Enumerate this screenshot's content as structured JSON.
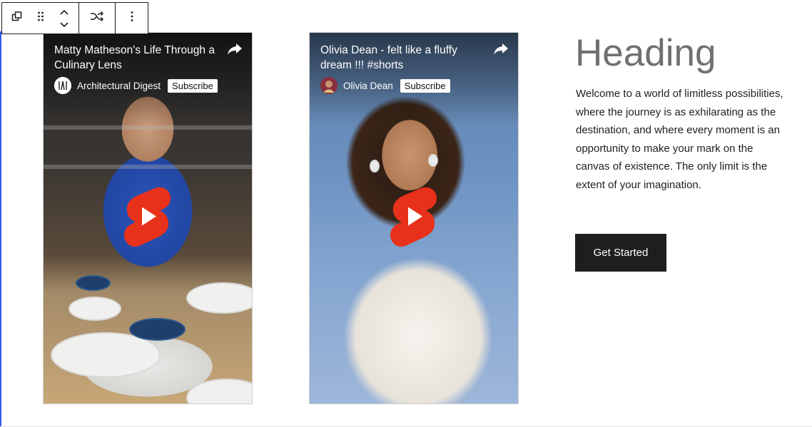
{
  "toolbar": {
    "icons": [
      "duplicate-block-icon",
      "drag-handle-icon",
      "move-up-icon",
      "move-down-icon",
      "shuffle-icon",
      "more-options-icon"
    ]
  },
  "videos": [
    {
      "title": "Matty Matheson's Life Through a Culinary Lens",
      "channel": "Architectural Digest",
      "subscribe_label": "Subscribe",
      "icons": [
        "share-icon",
        "channel-avatar-icon",
        "youtube-shorts-play-icon"
      ]
    },
    {
      "title": "Olivia Dean - felt like a fluffy dream !!! #shorts",
      "channel": "Olivia Dean",
      "subscribe_label": "Subscribe",
      "icons": [
        "share-icon",
        "channel-avatar-icon",
        "youtube-shorts-play-icon"
      ]
    }
  ],
  "content": {
    "heading": "Heading",
    "body": "Welcome to a world of limitless possibilities, where the journey is as exhilarating as the destination, and where every moment is an opportunity to make your mark on the canvas of existence. The only limit is the extent of your imagination.",
    "button_label": "Get Started"
  },
  "colors": {
    "accent": "#3858e9",
    "button_bg": "#1e1e1e",
    "heading": "#707070",
    "shorts_red": "#e8311a"
  }
}
